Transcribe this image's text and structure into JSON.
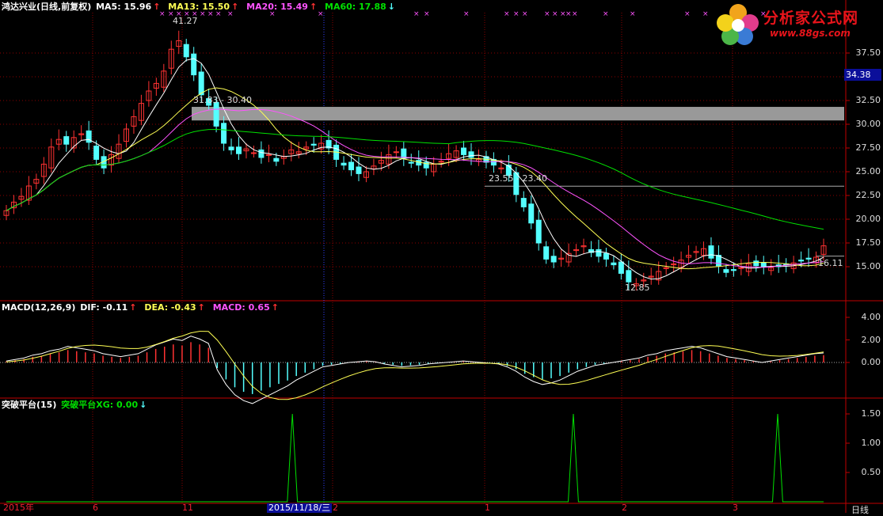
{
  "main_header": {
    "title": "鸿达兴业(日线,前复权)",
    "ma5_label": "MA5: 15.96",
    "ma5_arrow": "↑",
    "ma13_label": "MA13: 15.50",
    "ma13_arrow": "↑",
    "ma20_label": "MA20: 15.49",
    "ma20_arrow": "↑",
    "ma60_label": "MA60: 17.88",
    "ma60_arrow": "↓"
  },
  "macd_header": {
    "title": "MACD(12,26,9)",
    "dif_label": "DIF: -0.11",
    "dif_arrow": "↑",
    "dea_label": "DEA: -0.43",
    "dea_arrow": "↑",
    "macd_label": "MACD: 0.65",
    "macd_arrow": "↑"
  },
  "breakout_header": {
    "title": "突破平台(15)",
    "xg_label": "突破平台XG: 0.00",
    "xg_arrow": "↓"
  },
  "logo": {
    "name": "分析家公式网",
    "url": "www.88gs.com"
  },
  "price_axis": [
    "37.50",
    "35.00",
    "32.50",
    "30.00",
    "27.50",
    "25.00",
    "22.50",
    "20.00",
    "17.50",
    "15.00"
  ],
  "current_price": "34.38",
  "macd_axis": [
    "4.00",
    "2.00",
    "0.00"
  ],
  "breakout_axis": [
    "1.50",
    "1.00",
    "0.50"
  ],
  "annotations": {
    "high": "41.27",
    "plateau": "31.83 - 30.40",
    "mid": "23.55 - 23.40",
    "low": "12.85",
    "last": "16.11"
  },
  "dates": [
    "2015年",
    "6",
    "11",
    "2015/11/18/三",
    "2",
    "1",
    "2",
    "3"
  ],
  "period_label": "日线",
  "colors": {
    "up": "#ff3232",
    "down": "#54ffff",
    "ma5": "#ffffff",
    "ma13": "#ffff54",
    "ma20": "#ff54ff",
    "ma60": "#00e000",
    "grid": "#8b0000",
    "axis": "#c00000"
  },
  "chart_data": [
    {
      "type": "line",
      "name": "price",
      "closes": [
        20.9,
        21.8,
        22.4,
        23.5,
        24.2,
        25.8,
        27.6,
        28.4,
        27.9,
        28.6,
        29.0,
        28.1,
        26.3,
        25.4,
        26.8,
        27.9,
        29.5,
        30.8,
        32.2,
        33.5,
        34.3,
        35.6,
        37.9,
        38.8,
        37.1,
        35.2,
        33.1,
        32.0,
        29.8,
        28.0,
        27.3,
        26.9,
        27.4,
        27.0,
        26.5,
        26.8,
        26.1,
        26.6,
        27.3,
        27.1,
        27.6,
        27.8,
        28.0,
        27.5,
        26.3,
        25.7,
        25.2,
        24.8,
        25.0,
        25.6,
        26.2,
        26.8,
        27.1,
        26.4,
        25.9,
        25.7,
        25.4,
        25.8,
        26.1,
        26.9,
        27.2,
        26.8,
        26.5,
        26.3,
        26.0,
        25.7,
        25.4,
        24.6,
        22.6,
        21.3,
        19.6,
        17.5,
        15.8,
        15.5,
        15.9,
        16.4,
        16.8,
        17.2,
        16.5,
        16.1,
        15.8,
        15.2,
        14.3,
        13.4,
        13.2,
        13.6,
        14.0,
        14.5,
        14.9,
        15.3,
        15.7,
        16.2,
        16.6,
        16.9,
        15.9,
        15.1,
        14.4,
        14.6,
        14.9,
        15.3,
        15.1,
        15.0,
        14.9,
        15.0,
        15.2,
        15.4,
        15.6,
        15.8,
        16.0,
        17.2
      ],
      "xlabel": "",
      "ylabel": "",
      "ylim": [
        12,
        41
      ]
    },
    {
      "type": "bar",
      "name": "MACD",
      "values": [
        0.1,
        0.2,
        0.3,
        0.5,
        0.6,
        0.8,
        0.9,
        1.1,
        1.0,
        0.9,
        0.8,
        0.6,
        0.5,
        0.4,
        0.5,
        0.6,
        0.9,
        1.2,
        1.4,
        1.6,
        1.5,
        1.8,
        1.6,
        1.3,
        -0.5,
        -1.5,
        -2.2,
        -2.6,
        -2.8,
        -2.5,
        -2.2,
        -1.9,
        -1.6,
        -1.2,
        -0.9,
        -0.6,
        -0.3,
        -0.2,
        -0.1,
        0.0,
        0.05,
        0.1,
        0.05,
        -0.1,
        -0.2,
        -0.3,
        -0.25,
        -0.2,
        -0.1,
        -0.05,
        0.0,
        0.05,
        0.1,
        0.05,
        0.0,
        -0.05,
        -0.1,
        -0.3,
        -0.6,
        -1.0,
        -1.3,
        -1.5,
        -1.4,
        -1.2,
        -0.9,
        -0.6,
        -0.4,
        -0.2,
        -0.1,
        0.0,
        0.1,
        0.2,
        0.3,
        0.5,
        0.6,
        0.8,
        0.9,
        1.0,
        1.1,
        1.0,
        0.8,
        0.6,
        0.4,
        0.3,
        0.2,
        0.1,
        0.0,
        0.1,
        0.2,
        0.3,
        0.4,
        0.5,
        0.6,
        0.65
      ],
      "ylim": [
        -3,
        4.5
      ]
    },
    {
      "type": "line",
      "name": "突破平台XG",
      "x": [
        0,
        55,
        56,
        57,
        110,
        111,
        112,
        150,
        151,
        152,
        160
      ],
      "values": [
        0,
        0,
        1.5,
        0,
        0,
        1.5,
        0,
        0,
        1.5,
        0,
        0
      ],
      "ylim": [
        0,
        1.7
      ]
    }
  ]
}
